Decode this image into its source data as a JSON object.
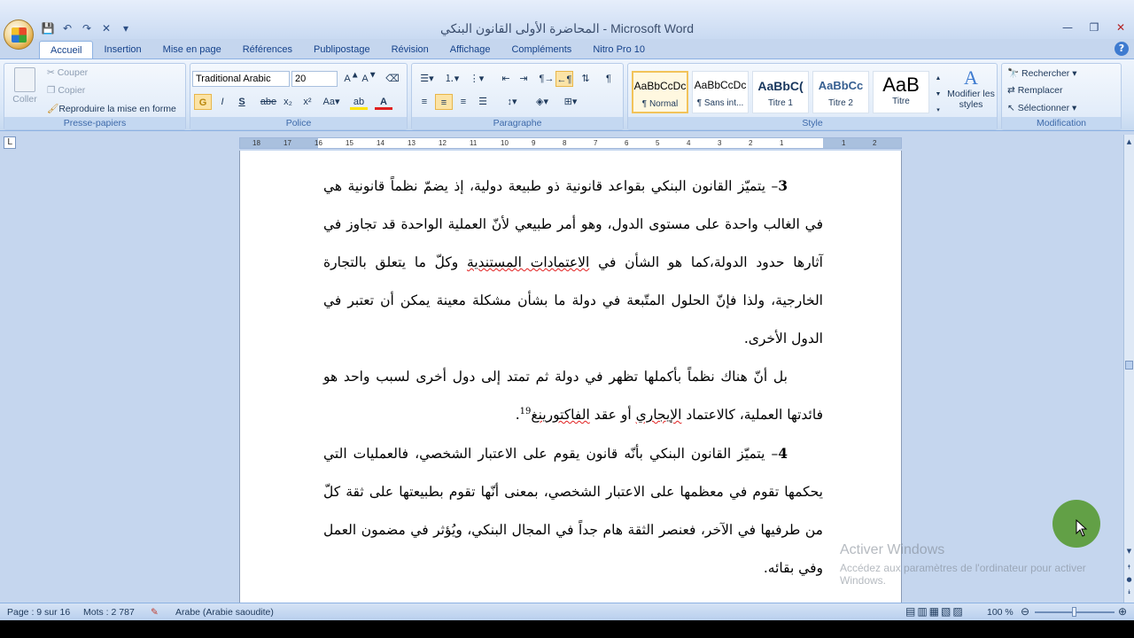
{
  "window": {
    "title": "المحاضرة الأولى القانون البنكي - Microsoft Word"
  },
  "tabs": [
    "Accueil",
    "Insertion",
    "Mise en page",
    "Références",
    "Publipostage",
    "Révision",
    "Affichage",
    "Compléments",
    "Nitro Pro 10"
  ],
  "ribbon": {
    "clipboard": {
      "label": "Presse-papiers",
      "paste": "Coller",
      "cut": "Couper",
      "copy": "Copier",
      "format_painter": "Reproduire la mise en forme"
    },
    "font": {
      "label": "Police",
      "family": "Traditional Arabic",
      "size": "20"
    },
    "paragraph": {
      "label": "Paragraphe"
    },
    "styles": {
      "label": "Style",
      "items": [
        {
          "sample": "AaBbCcDc",
          "name": "¶ Normal"
        },
        {
          "sample": "AaBbCcDc",
          "name": "¶ Sans int..."
        },
        {
          "sample": "AaBbC(",
          "name": "Titre 1"
        },
        {
          "sample": "AaBbCc",
          "name": "Titre 2"
        },
        {
          "sample": "AaB",
          "name": "Titre"
        }
      ],
      "modify": "Modifier les styles"
    },
    "editing": {
      "label": "Modification",
      "find": "Rechercher",
      "replace": "Remplacer",
      "select": "Sélectionner"
    }
  },
  "ruler": {
    "ticks": [
      "18",
      "17",
      "16",
      "15",
      "14",
      "13",
      "12",
      "11",
      "10",
      "9",
      "8",
      "7",
      "6",
      "5",
      "4",
      "3",
      "2",
      "1",
      "",
      "1",
      "2"
    ]
  },
  "document": {
    "p1_num": "3",
    "p1_lead": "– يتميّز القانون البنكي بقواعد قانونية ذو طبيعة دولية، إذ يضمّ نظماً قانونية هي في الغالب واحدة على مستوى الدول، وهو أمر طبيعي لأنّ العملية الواحدة قد تجاوز في آثارها حدود الدولة،كما هو الشأن في ",
    "p1_mark": "الاعتمادات المستندية",
    "p1_tail": " وكلّ ما يتعلق بالتجارة الخارجية، ولذا فإنّ الحلول المتّبعة في دولة ما بشأن مشكلة معينة يمكن أن تعتبر في الدول الأخرى.",
    "p2_lead": "بل أنّ هناك نظماً بأكملها تظهر في دولة ثم تمتد إلى دول أخرى لسبب واحد هو فائدتها العملية، كالاعتماد ",
    "p2_mark1": "الإيجاري",
    "p2_mid": " أو عقد ",
    "p2_mark2": "الفاكتورينغ",
    "p2_sup": "19",
    "p2_end": ".",
    "p3_num": "4",
    "p3_text": "– يتميّز القانون البنكي بأنّه قانون يقوم على الاعتبار الشخصي، فالعمليات التي يحكمها تقوم في معظمها على الاعتبار الشخصي، بمعنى أنّها تقوم بطبيعتها على ثقة كلّ من طرفيها في الآخر، فعنصر الثقة هام جداً في المجال البنكي، ويُؤثر في مضمون العمل وفي بقائه."
  },
  "statusbar": {
    "page": "Page : 9 sur 16",
    "words": "Mots : 2 787",
    "language": "Arabe (Arabie saoudite)",
    "zoom": "100 %"
  },
  "watermark": {
    "line1": "Activer Windows",
    "line2": "Accédez aux paramètres de l'ordinateur pour activer Windows."
  }
}
